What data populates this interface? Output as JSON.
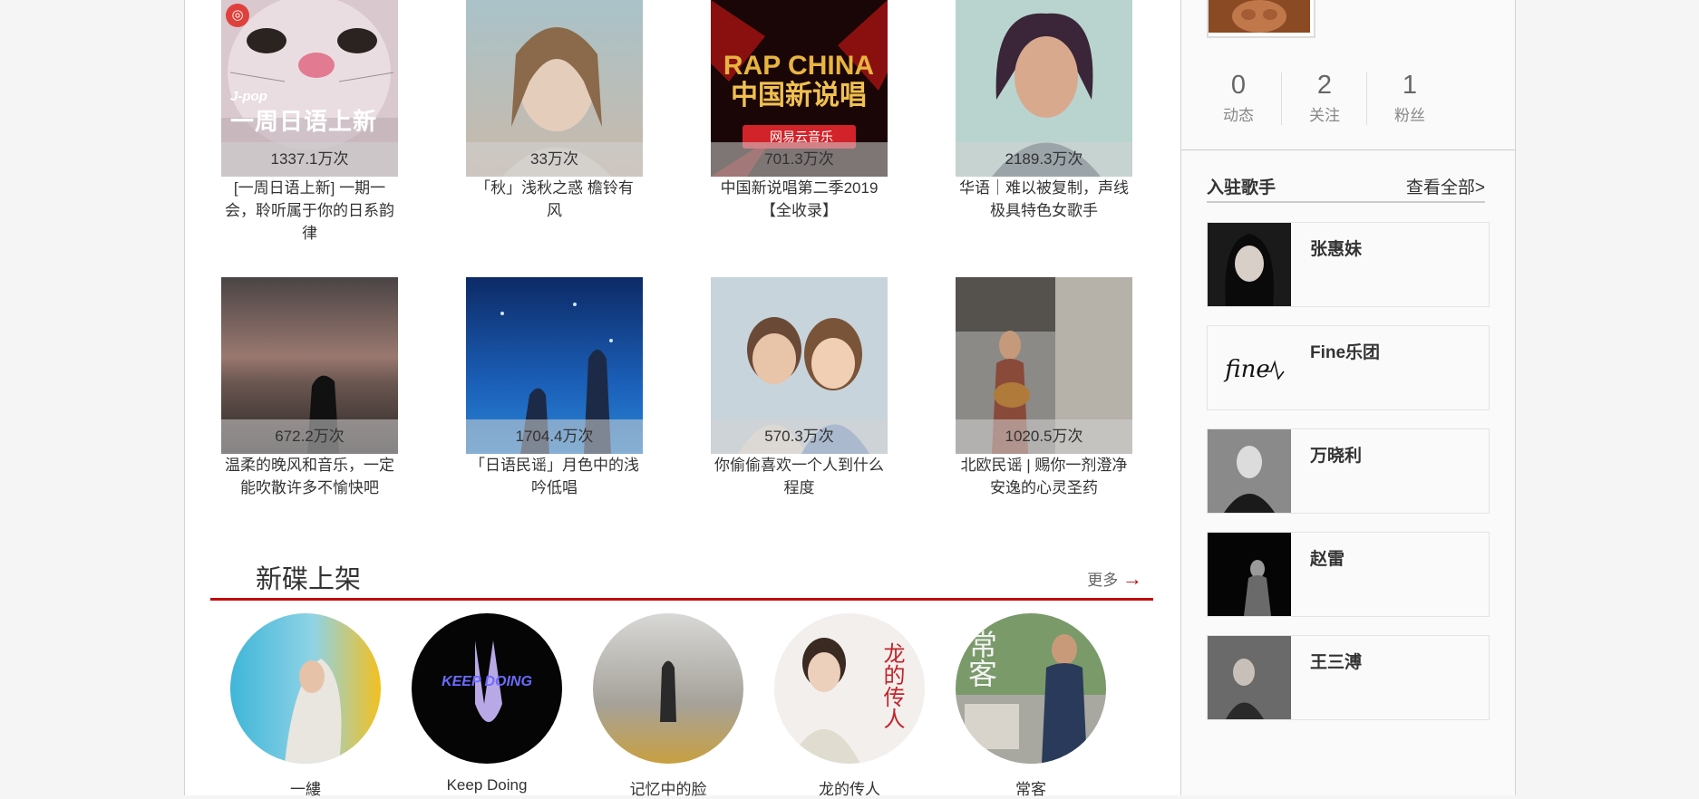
{
  "playlists": [
    {
      "title": "[一周日语上新] 一期一会，聆听属于你的日系韵律",
      "count": "1337.1万次",
      "overlay_small": "J-pop",
      "overlay_big": "一周日语上新"
    },
    {
      "title": "「秋」浅秋之惑 檐铃有风",
      "count": "33万次"
    },
    {
      "title": "中国新说唱第二季2019【全收录】",
      "count": "701.3万次",
      "cover_text": "RAP CHINA",
      "cover_sub": "中国新说唱",
      "cover_brand": "网易云音乐"
    },
    {
      "title": "华语｜难以被复制，声线极具特色女歌手",
      "count": "2189.3万次"
    },
    {
      "title": "温柔的晚风和音乐，一定能吹散许多不愉快吧",
      "count": "672.2万次"
    },
    {
      "title": "「日语民谣」月色中的浅吟低唱",
      "count": "1704.4万次"
    },
    {
      "title": "你偷偷喜欢一个人到什么程度",
      "count": "570.3万次"
    },
    {
      "title": "北欧民谣 | 赐你一剂澄净安逸的心灵圣药",
      "count": "1020.5万次"
    }
  ],
  "new_discs": {
    "title": "新碟上架",
    "more": "更多",
    "items": [
      {
        "name": "一縷"
      },
      {
        "name": "Keep Doing",
        "cover_text": "KEEP DOING"
      },
      {
        "name": "记忆中的脸"
      },
      {
        "name": "龙的传人",
        "cover_text": "龙的传人"
      },
      {
        "name": "常客",
        "cover_text": "常客"
      }
    ]
  },
  "profile": {
    "stats": [
      {
        "num": "0",
        "label": "动态"
      },
      {
        "num": "2",
        "label": "关注"
      },
      {
        "num": "1",
        "label": "粉丝"
      }
    ]
  },
  "artists": {
    "title": "入驻歌手",
    "more": "查看全部>",
    "items": [
      {
        "name": "张惠妹"
      },
      {
        "name": "Fine乐团",
        "logo_text": "fine"
      },
      {
        "name": "万晓利"
      },
      {
        "name": "赵雷"
      },
      {
        "name": "王三溥"
      }
    ]
  },
  "colors": {
    "accent": "#c20c0c",
    "page_bg": "#f5f5f5",
    "sidebar_bg": "#fafafa"
  }
}
